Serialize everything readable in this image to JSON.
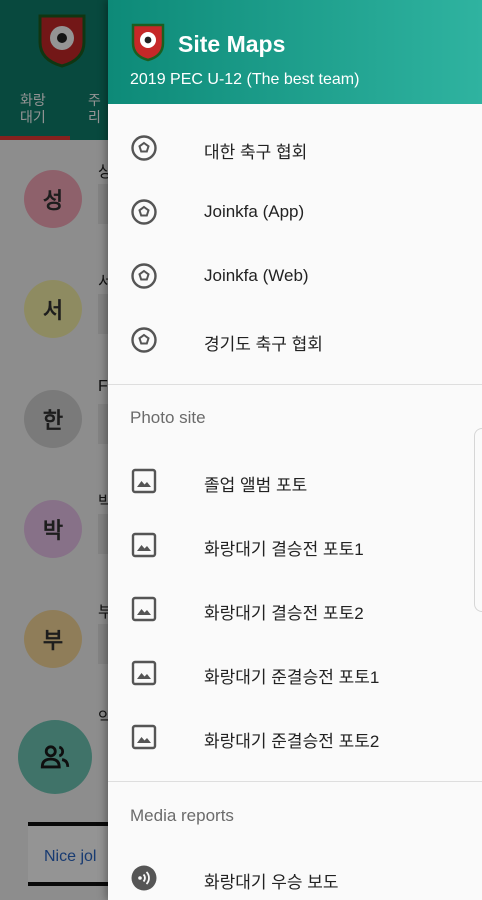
{
  "background": {
    "tabs": [
      "화랑\n대기",
      "주\n리"
    ],
    "contacts": [
      {
        "initial": "성",
        "name_fragment": "상",
        "color": "#f4a7b9"
      },
      {
        "initial": "서",
        "name_fragment": "서",
        "color": "#f5f0a8"
      },
      {
        "initial": "한",
        "name_fragment": "F",
        "color": "#d2d2d2"
      },
      {
        "initial": "박",
        "name_fragment": "박",
        "color": "#e9c3ea"
      },
      {
        "initial": "부",
        "name_fragment": "부",
        "color": "#f6d89a"
      }
    ],
    "last_name_fragment": "약",
    "message_text": "Nice jol"
  },
  "drawer": {
    "title": "Site Maps",
    "subtitle": "2019 PEC U-12 (The best team)",
    "links": [
      {
        "label": "대한 축구 협회",
        "icon": "soccer-ball-icon"
      },
      {
        "label": "Joinkfa (App)",
        "icon": "soccer-ball-icon"
      },
      {
        "label": "Joinkfa (Web)",
        "icon": "soccer-ball-icon"
      },
      {
        "label": "경기도 축구 협회",
        "icon": "soccer-ball-icon"
      }
    ],
    "photo_section_title": "Photo site",
    "photos": [
      {
        "label": "졸업 앨범 포토",
        "icon": "image-icon"
      },
      {
        "label": "화랑대기 결승전 포토1",
        "icon": "image-icon"
      },
      {
        "label": "화랑대기 결승전 포토2",
        "icon": "image-icon"
      },
      {
        "label": "화랑대기 준결승전 포토1",
        "icon": "image-icon"
      },
      {
        "label": "화랑대기 준결승전 포토2",
        "icon": "image-icon"
      }
    ],
    "media_section_title": "Media reports",
    "media": [
      {
        "label": "화랑대기 우승 보도",
        "icon": "broadcast-icon"
      }
    ]
  },
  "colors": {
    "header_start": "#0d8a78",
    "header_end": "#2fb3a0",
    "tab_indicator": "#e53935"
  }
}
